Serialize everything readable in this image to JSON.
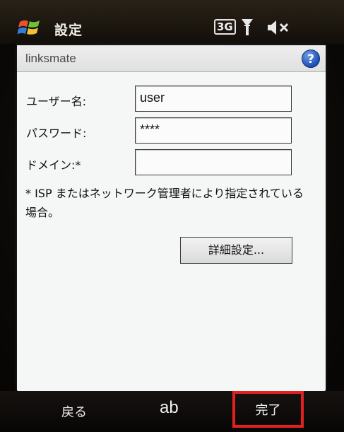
{
  "status_bar": {
    "app_title": "設定",
    "network": "3G",
    "icons": [
      "windows-logo-icon",
      "signal-antenna-icon",
      "volume-muted-icon"
    ]
  },
  "dialog": {
    "title": "linksmate",
    "help_label": "?",
    "fields": {
      "username": {
        "label": "ユーザー名:",
        "value": "user"
      },
      "password": {
        "label": "パスワード:",
        "value": "****"
      },
      "domain": {
        "label": "ドメイン:*",
        "value": ""
      }
    },
    "note": "* ISP またはネットワーク管理者により指定されている場合。",
    "advanced_button": "詳細設定..."
  },
  "soft_keys": {
    "back": "戻る",
    "input_mode": "ab",
    "done": "完了"
  },
  "colors": {
    "highlight_border": "#e32020",
    "help_button": "#1d4fb5",
    "panel_background": "#f5f6f6"
  }
}
